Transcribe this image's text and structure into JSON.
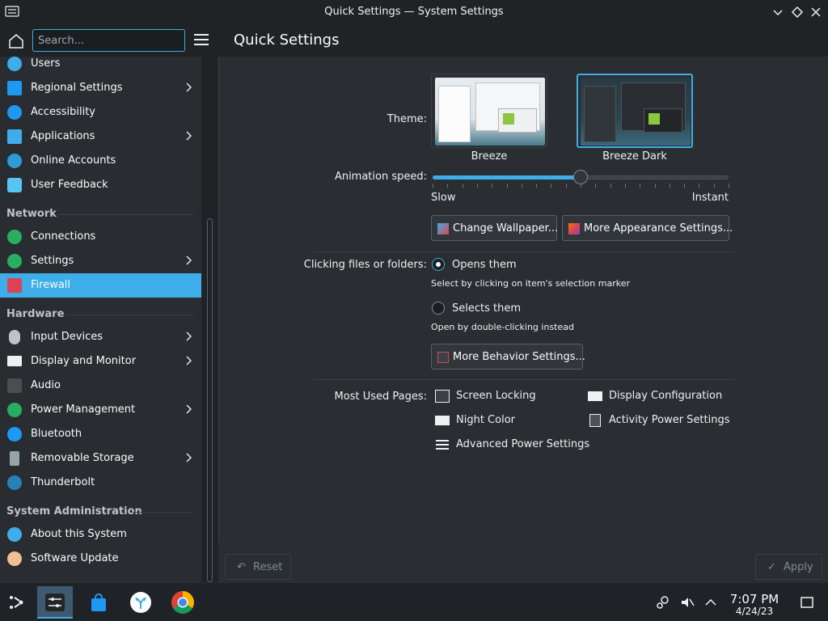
{
  "window": {
    "title": "Quick Settings — System Settings"
  },
  "search": {
    "placeholder": "Search..."
  },
  "sidebar": {
    "items_top": [
      {
        "label": "Users",
        "color": "#3daee9"
      },
      {
        "label": "Regional Settings",
        "color": "#3daee9"
      },
      {
        "label": "Accessibility",
        "color": "#3daee9"
      },
      {
        "label": "Applications",
        "color": "#3daee9"
      },
      {
        "label": "Online Accounts",
        "color": "#3daee9"
      },
      {
        "label": "User Feedback",
        "color": "#3daee9"
      }
    ],
    "network_header": "Network",
    "network_items": [
      {
        "label": "Connections"
      },
      {
        "label": "Settings"
      },
      {
        "label": "Firewall"
      }
    ],
    "hardware_header": "Hardware",
    "hardware_items": [
      {
        "label": "Input Devices"
      },
      {
        "label": "Display and Monitor"
      },
      {
        "label": "Audio"
      },
      {
        "label": "Power Management"
      },
      {
        "label": "Bluetooth"
      },
      {
        "label": "Removable Storage"
      },
      {
        "label": "Thunderbolt"
      }
    ],
    "sysadmin_header": "System Administration",
    "sysadmin_items": [
      {
        "label": "About this System"
      },
      {
        "label": "Software Update"
      }
    ]
  },
  "main": {
    "title": "Quick Settings",
    "theme_label": "Theme:",
    "themes": [
      {
        "name": "Breeze",
        "selected": false
      },
      {
        "name": "Breeze Dark",
        "selected": true
      }
    ],
    "animation_label": "Animation speed:",
    "animation_value_pct": 50,
    "slow_label": "Slow",
    "instant_label": "Instant",
    "change_wallpaper": "Change Wallpaper...",
    "more_appearance": "More Appearance Settings...",
    "clicking_label": "Clicking files or folders:",
    "opens_them": "Opens them",
    "opens_hint": "Select by clicking on item's selection marker",
    "selects_them": "Selects them",
    "selects_hint": "Open by double-clicking instead",
    "more_behavior": "More Behavior Settings...",
    "most_used_label": "Most Used Pages:",
    "most_used": [
      "Screen Locking",
      "Display Configuration",
      "Night Color",
      "Activity Power Settings",
      "Advanced Power Settings"
    ],
    "reset": "Reset",
    "apply": "Apply"
  },
  "taskbar": {
    "time": "7:07 PM",
    "date": "4/24/23"
  },
  "colors": {
    "accent": "#3daee9",
    "window_bg": "#202326",
    "view_bg": "#2a2e32"
  }
}
